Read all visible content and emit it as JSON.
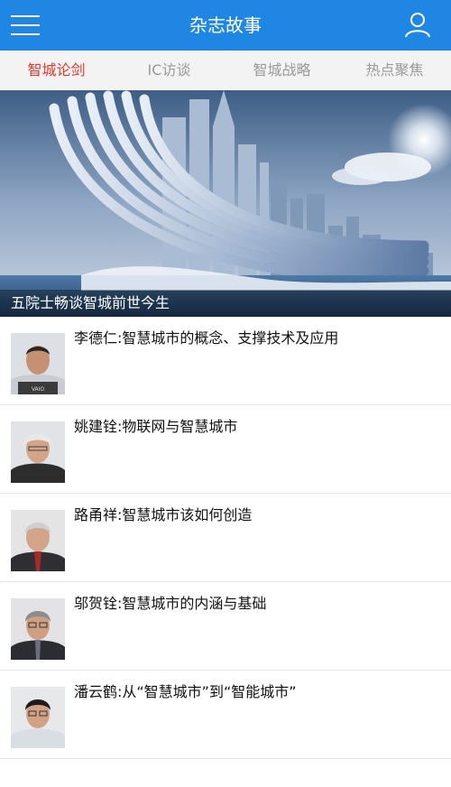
{
  "header": {
    "title": "杂志故事",
    "menu_icon": "hamburger-menu-icon",
    "user_icon": "user-profile-icon",
    "color": "#1f86e4"
  },
  "tabs": [
    {
      "label": "智城论剑",
      "active": true
    },
    {
      "label": "IC访谈",
      "active": false
    },
    {
      "label": "智城战略",
      "active": false
    },
    {
      "label": "热点聚焦",
      "active": false
    }
  ],
  "colors": {
    "active_tab": "#e0392d",
    "inactive_tab": "#9a9a9a"
  },
  "banner": {
    "caption": "五院士畅谈智城前世今生"
  },
  "articles": [
    {
      "title": "李德仁:智慧城市的概念、支撑技术及应用"
    },
    {
      "title": "姚建铨:物联网与智慧城市"
    },
    {
      "title": "路甬祥:智慧城市该如何创造"
    },
    {
      "title": "邬贺铨:智慧城市的内涵与基础"
    },
    {
      "title": "潘云鹤:从“智慧城市”到“智能城市”"
    }
  ]
}
